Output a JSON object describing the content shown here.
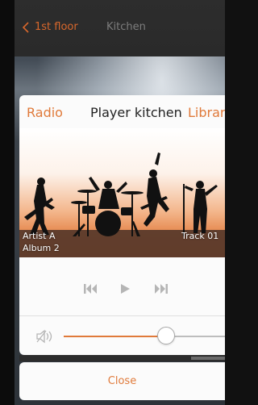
{
  "navbar": {
    "back_label": "1st floor",
    "title": "Kitchen"
  },
  "player": {
    "tab_radio": "Radio",
    "title": "Player kitchen",
    "tab_library": "Library",
    "artist": "Artist A",
    "album": "Album 2",
    "track": "Track 01",
    "volume_level_percent": 70
  },
  "close_label": "Close",
  "colors": {
    "accent": "#e07a3a",
    "nav_bg": "#2d2d2d",
    "sheet_bg": "#fbfbfb"
  }
}
